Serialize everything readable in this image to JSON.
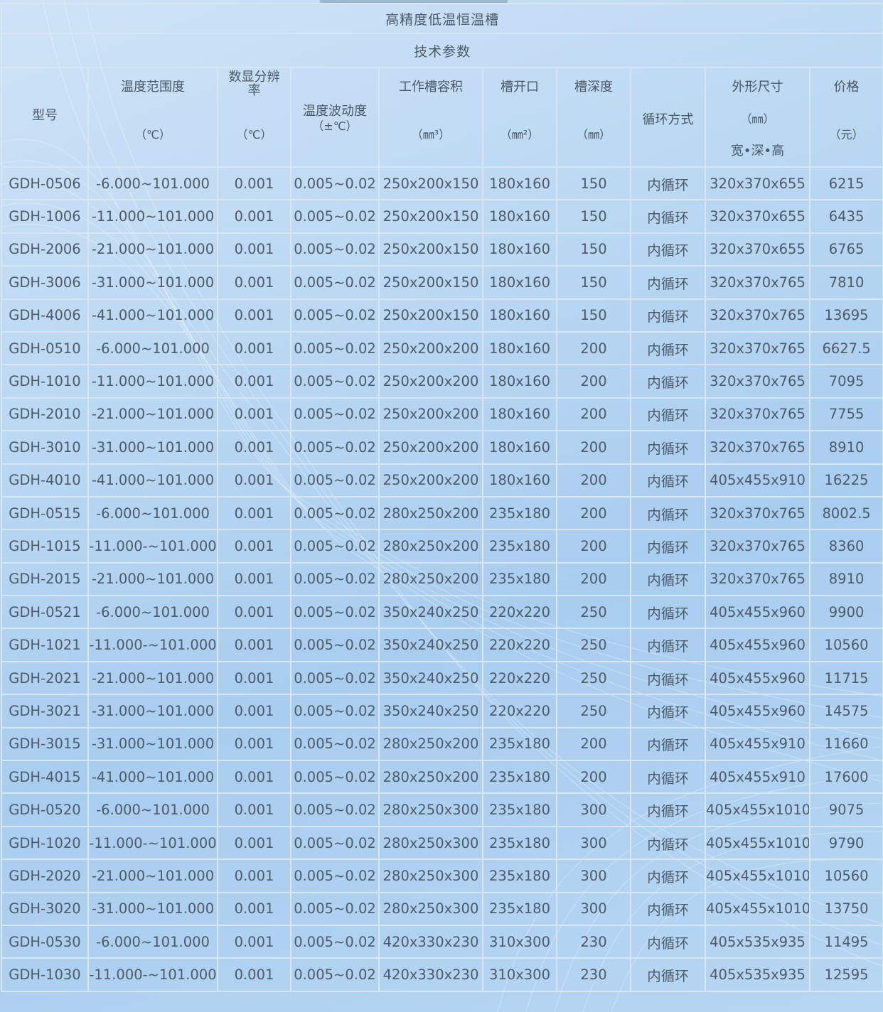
{
  "title": "高精度低温恒温槽",
  "subtitle": "技术参数",
  "headers": {
    "model": "型号",
    "temp_range": "温度范围度",
    "temp_range_unit": "（℃）",
    "resolution": "数显分辨率",
    "resolution_unit": "（℃）",
    "fluctuation": "温度波动度",
    "fluctuation_unit": "（±℃）",
    "volume": "工作槽容积",
    "volume_unit": "（㎜³）",
    "opening": "槽开口",
    "opening_unit": "（㎜²）",
    "depth": "槽深度",
    "depth_unit": "（㎜）",
    "circulation": "循环方式",
    "size": "外形尺寸",
    "size_unit": "（㎜）",
    "size_dims": "宽•深•高",
    "price": "价格",
    "price_unit": "（元）"
  },
  "rows": [
    {
      "model": "GDH-0506",
      "range": "-6.000~101.000",
      "res": "0.001",
      "fluct": "0.005~0.02",
      "vol": "250x200x150",
      "open": "180x160",
      "depth": "150",
      "circ": "内循环",
      "size": "320x370x655",
      "price": "6215"
    },
    {
      "model": "GDH-1006",
      "range": "-11.000~101.000",
      "res": "0.001",
      "fluct": "0.005~0.02",
      "vol": "250x200x150",
      "open": "180x160",
      "depth": "150",
      "circ": "内循环",
      "size": "320x370x655",
      "price": "6435"
    },
    {
      "model": "GDH-2006",
      "range": "-21.000~101.000",
      "res": "0.001",
      "fluct": "0.005~0.02",
      "vol": "250x200x150",
      "open": "180x160",
      "depth": "150",
      "circ": "内循环",
      "size": "320x370x655",
      "price": "6765"
    },
    {
      "model": "GDH-3006",
      "range": "-31.000~101.000",
      "res": "0.001",
      "fluct": "0.005~0.02",
      "vol": "250x200x150",
      "open": "180x160",
      "depth": "150",
      "circ": "内循环",
      "size": "320x370x765",
      "price": "7810"
    },
    {
      "model": "GDH-4006",
      "range": "-41.000~101.000",
      "res": "0.001",
      "fluct": "0.005~0.02",
      "vol": "250x200x150",
      "open": "180x160",
      "depth": "150",
      "circ": "内循环",
      "size": "320x370x765",
      "price": "13695"
    },
    {
      "model": "GDH-0510",
      "range": "-6.000~101.000",
      "res": "0.001",
      "fluct": "0.005~0.02",
      "vol": "250x200x200",
      "open": "180x160",
      "depth": "200",
      "circ": "内循环",
      "size": "320x370x765",
      "price": "6627.5"
    },
    {
      "model": "GDH-1010",
      "range": "-11.000~101.000",
      "res": "0.001",
      "fluct": "0.005~0.02",
      "vol": "250x200x200",
      "open": "180x160",
      "depth": "200",
      "circ": "内循环",
      "size": "320x370x765",
      "price": "7095"
    },
    {
      "model": "GDH-2010",
      "range": "-21.000~101.000",
      "res": "0.001",
      "fluct": "0.005~0.02",
      "vol": "250x200x200",
      "open": "180x160",
      "depth": "200",
      "circ": "内循环",
      "size": "320x370x765",
      "price": "7755"
    },
    {
      "model": "GDH-3010",
      "range": "-31.000~101.000",
      "res": "0.001",
      "fluct": "0.005~0.02",
      "vol": "250x200x200",
      "open": "180x160",
      "depth": "200",
      "circ": "内循环",
      "size": "320x370x765",
      "price": "8910"
    },
    {
      "model": "GDH-4010",
      "range": "-41.000~101.000",
      "res": "0.001",
      "fluct": "0.005~0.02",
      "vol": "250x200x200",
      "open": "180x160",
      "depth": "200",
      "circ": "内循环",
      "size": "405x455x910",
      "price": "16225"
    },
    {
      "model": "GDH-0515",
      "range": "-6.000~101.000",
      "res": "0.001",
      "fluct": "0.005~0.02",
      "vol": "280x250x200",
      "open": "235x180",
      "depth": "200",
      "circ": "内循环",
      "size": "320x370x765",
      "price": "8002.5"
    },
    {
      "model": "GDH-1015",
      "range": "-11.000-~101.000",
      "res": "0.001",
      "fluct": "0.005~0.02",
      "vol": "280x250x200",
      "open": "235x180",
      "depth": "200",
      "circ": "内循环",
      "size": "320x370x765",
      "price": "8360"
    },
    {
      "model": "GDH-2015",
      "range": "-21.000~101.000",
      "res": "0.001",
      "fluct": "0.005~0.02",
      "vol": "280x250x200",
      "open": "235x180",
      "depth": "200",
      "circ": "内循环",
      "size": "320x370x765",
      "price": "8910"
    },
    {
      "model": "GDH-0521",
      "range": "-6.000~101.000",
      "res": "0.001",
      "fluct": "0.005~0.02",
      "vol": "350x240x250",
      "open": "220x220",
      "depth": "250",
      "circ": "内循环",
      "size": "405x455x960",
      "price": "9900"
    },
    {
      "model": "GDH-1021",
      "range": "-11.000-~101.000",
      "res": "0.001",
      "fluct": "0.005~0.02",
      "vol": "350x240x250",
      "open": "220x220",
      "depth": "250",
      "circ": "内循环",
      "size": "405x455x960",
      "price": "10560"
    },
    {
      "model": "GDH-2021",
      "range": "-21.000~101.000",
      "res": "0.001",
      "fluct": "0.005~0.02",
      "vol": "350x240x250",
      "open": "220x220",
      "depth": "250",
      "circ": "内循环",
      "size": "405x455x960",
      "price": "11715"
    },
    {
      "model": "GDH-3021",
      "range": "-31.000~101.000",
      "res": "0.001",
      "fluct": "0.005~0.02",
      "vol": "350x240x250",
      "open": "220x220",
      "depth": "250",
      "circ": "内循环",
      "size": "405x455x960",
      "price": "14575"
    },
    {
      "model": "GDH-3015",
      "range": "-31.000~101.000",
      "res": "0.001",
      "fluct": "0.005~0.02",
      "vol": "280x250x200",
      "open": "235x180",
      "depth": "200",
      "circ": "内循环",
      "size": "405x455x910",
      "price": "11660"
    },
    {
      "model": "GDH-4015",
      "range": "-41.000~101.000",
      "res": "0.001",
      "fluct": "0.005~0.02",
      "vol": "280x250x200",
      "open": "235x180",
      "depth": "200",
      "circ": "内循环",
      "size": "405x455x910",
      "price": "17600"
    },
    {
      "model": "GDH-0520",
      "range": "-6.000~101.000",
      "res": "0.001",
      "fluct": "0.005~0.02",
      "vol": "280x250x300",
      "open": "235x180",
      "depth": "300",
      "circ": "内循环",
      "size": "405x455x1010",
      "price": "9075"
    },
    {
      "model": "GDH-1020",
      "range": "-11.000-~101.000",
      "res": "0.001",
      "fluct": "0.005~0.02",
      "vol": "280x250x300",
      "open": "235x180",
      "depth": "300",
      "circ": "内循环",
      "size": "405x455x1010",
      "price": "9790"
    },
    {
      "model": "GDH-2020",
      "range": "-21.000~101.000",
      "res": "0.001",
      "fluct": "0.005~0.02",
      "vol": "280x250x300",
      "open": "235x180",
      "depth": "300",
      "circ": "内循环",
      "size": "405x455x1010",
      "price": "10560"
    },
    {
      "model": "GDH-3020",
      "range": "-31.000~101.000",
      "res": "0.001",
      "fluct": "0.005~0.02",
      "vol": "280x250x300",
      "open": "235x180",
      "depth": "300",
      "circ": "内循环",
      "size": "405x455x1010",
      "price": "13750"
    },
    {
      "model": "GDH-0530",
      "range": "-6.000~101.000",
      "res": "0.001",
      "fluct": "0.005~0.02",
      "vol": "420x330x230",
      "open": "310x300",
      "depth": "230",
      "circ": "内循环",
      "size": "405x535x935",
      "price": "11495"
    },
    {
      "model": "GDH-1030",
      "range": "-11.000-~101.000",
      "res": "0.001",
      "fluct": "0.005~0.02",
      "vol": "420x330x230",
      "open": "310x300",
      "depth": "230",
      "circ": "内循环",
      "size": "405x535x935",
      "price": "12595"
    }
  ]
}
